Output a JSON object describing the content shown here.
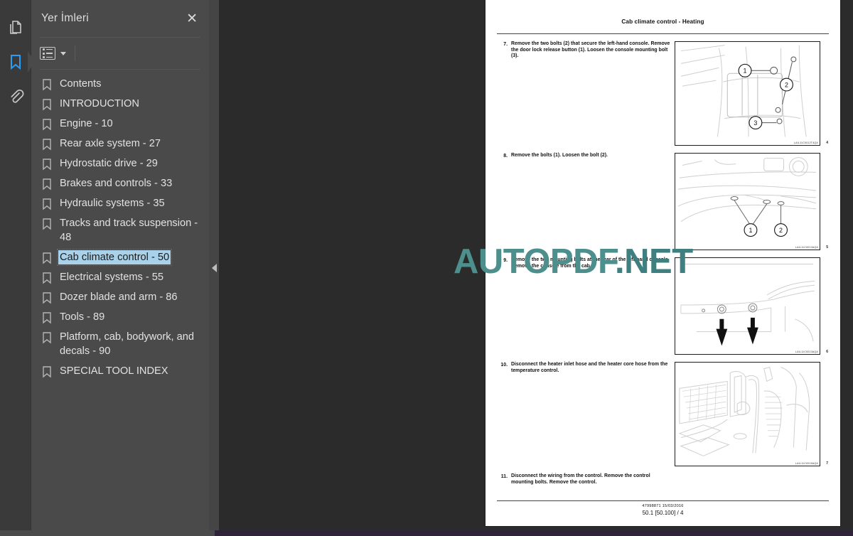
{
  "rail": {
    "items": [
      {
        "name": "pages-icon",
        "label": "Sayfalar"
      },
      {
        "name": "bookmark-icon",
        "label": "Yer İmleri",
        "active": true
      },
      {
        "name": "attachment-icon",
        "label": "Ekler"
      }
    ]
  },
  "panel": {
    "title": "Yer İmleri",
    "close_label": "✕",
    "options_icon": "list-options-icon",
    "dropdown_icon": "chevron-down-icon",
    "collapse_icon": "collapse-left-icon",
    "selection_color": "#a9d2ea",
    "bookmarks": [
      {
        "label": "Contents"
      },
      {
        "label": "INTRODUCTION"
      },
      {
        "label": "Engine - 10"
      },
      {
        "label": "Rear axle system - 27"
      },
      {
        "label": "Hydrostatic drive - 29"
      },
      {
        "label": "Brakes and controls - 33"
      },
      {
        "label": "Hydraulic systems - 35"
      },
      {
        "label": "Tracks and track suspension - 48"
      },
      {
        "label": "Cab climate control - 50",
        "selected": true
      },
      {
        "label": "Electrical systems - 55"
      },
      {
        "label": "Dozer blade and arm - 86"
      },
      {
        "label": "Tools - 89"
      },
      {
        "label": "Platform, cab, bodywork, and decals - 90"
      },
      {
        "label": "SPECIAL TOOL INDEX"
      }
    ]
  },
  "watermark": {
    "text_a": "AUTOPDF",
    "text_b": ".NET",
    "color": "#3f8585"
  },
  "document": {
    "header": "Cab climate control - Heating",
    "steps": [
      {
        "number": "7.",
        "text": "Remove the two bolts (2) that secure the left-hand console.  Remove the door lock release button (1).  Loosen the console mounting bolt (3).",
        "figure_caption": "LAIL11C0012T4QA",
        "figure_number": "4"
      },
      {
        "number": "8.",
        "text": "Remove the bolts (1). Loosen the bolt (2).",
        "figure_caption": "LAIL11C0013AQA",
        "figure_number": "5"
      },
      {
        "number": "9.",
        "text": "Remove the two mounting bolts at the rear of the left-hand console.  Remove the console from the cab.",
        "figure_caption": "LAIL11C0013AQA",
        "figure_number": "6"
      },
      {
        "number": "10.",
        "text": "Disconnect the heater inlet hose and the heater core hose from the temperature control.",
        "figure_caption": "LAIL11C0015AQA",
        "figure_number": "7"
      },
      {
        "number": "11.",
        "text": "Disconnect the wiring from the control.  Remove the control mounting bolts.  Remove the control.",
        "figure_caption": "",
        "figure_number": ""
      }
    ],
    "footer_line1": "47998871 15/03/2016",
    "footer_line2": "50.1 [50.100] / 4"
  }
}
